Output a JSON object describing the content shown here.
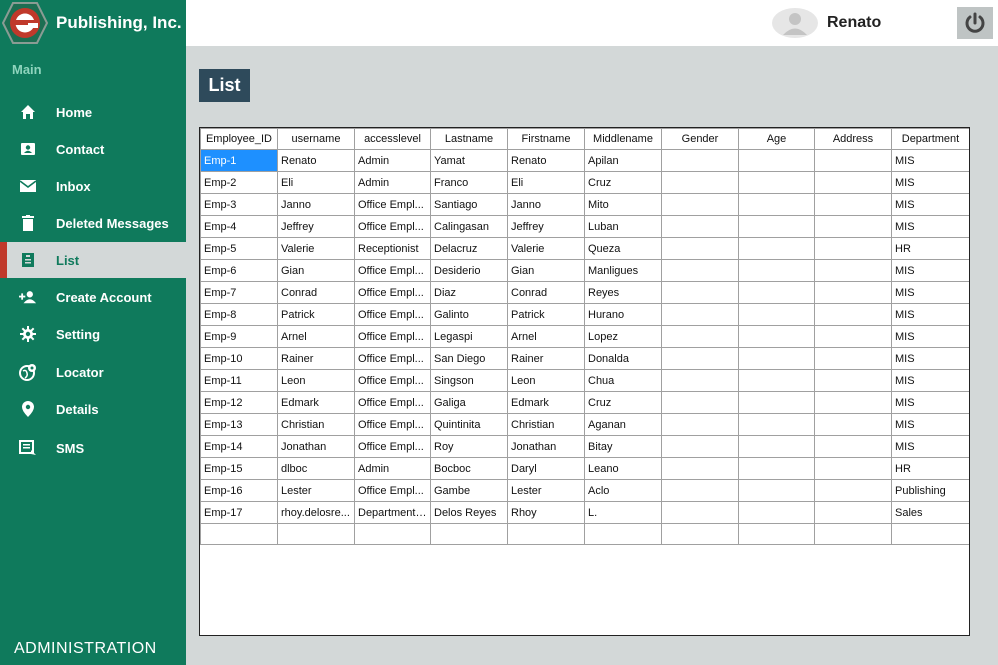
{
  "brand": {
    "name": "Publishing, Inc.",
    "logo_letter": "e",
    "color": "#0f7a5c",
    "accent": "#c0392b"
  },
  "topbar": {
    "user_name": "Renato",
    "avatar_icon": "user-avatar-icon",
    "logout_icon": "power-icon"
  },
  "sidebar": {
    "section_label": "Main",
    "items": [
      {
        "label": "Home",
        "icon": "home-icon"
      },
      {
        "label": "Contact",
        "icon": "contact-card-icon"
      },
      {
        "label": "Inbox",
        "icon": "mail-icon"
      },
      {
        "label": "Deleted Messages",
        "icon": "trash-icon"
      },
      {
        "label": "List",
        "icon": "list-icon",
        "active": true
      },
      {
        "label": "Create Account",
        "icon": "add-user-icon"
      },
      {
        "label": "Setting",
        "icon": "gear-icon"
      },
      {
        "label": "Locator",
        "icon": "globe-pin-icon"
      },
      {
        "label": "Details",
        "icon": "location-pin-icon"
      },
      {
        "label": "SMS",
        "icon": "sms-icon"
      }
    ],
    "footer_label": "ADMINISTRATION"
  },
  "main": {
    "title": "List",
    "table": {
      "columns": [
        "Employee_ID",
        "username",
        "accesslevel",
        "Lastname",
        "Firstname",
        "Middlename",
        "Gender",
        "Age",
        "Address",
        "Department"
      ],
      "selected_cell": [
        0,
        0
      ],
      "rows": [
        [
          "Emp-1",
          "Renato",
          "Admin",
          "Yamat",
          "Renato",
          "Apilan",
          "",
          "",
          "",
          "MIS"
        ],
        [
          "Emp-2",
          "Eli",
          "Admin",
          "Franco",
          "Eli",
          "Cruz",
          "",
          "",
          "",
          "MIS"
        ],
        [
          "Emp-3",
          "Janno",
          "Office Empl...",
          "Santiago",
          "Janno",
          "Mito",
          "",
          "",
          "",
          "MIS"
        ],
        [
          "Emp-4",
          "Jeffrey",
          "Office Empl...",
          "Calingasan",
          "Jeffrey",
          "Luban",
          "",
          "",
          "",
          "MIS"
        ],
        [
          "Emp-5",
          "Valerie",
          "Receptionist",
          "Delacruz",
          "Valerie",
          "Queza",
          "",
          "",
          "",
          "HR"
        ],
        [
          "Emp-6",
          "Gian",
          "Office Empl...",
          "Desiderio",
          "Gian",
          "Manligues",
          "",
          "",
          "",
          "MIS"
        ],
        [
          "Emp-7",
          "Conrad",
          "Office Empl...",
          "Diaz",
          "Conrad",
          "Reyes",
          "",
          "",
          "",
          "MIS"
        ],
        [
          "Emp-8",
          "Patrick",
          "Office Empl...",
          "Galinto",
          "Patrick",
          "Hurano",
          "",
          "",
          "",
          "MIS"
        ],
        [
          "Emp-9",
          "Arnel",
          "Office Empl...",
          "Legaspi",
          "Arnel",
          "Lopez",
          "",
          "",
          "",
          "MIS"
        ],
        [
          "Emp-10",
          "Rainer",
          "Office Empl...",
          "San Diego",
          "Rainer",
          "Donalda",
          "",
          "",
          "",
          "MIS"
        ],
        [
          "Emp-11",
          "Leon",
          "Office Empl...",
          "Singson",
          "Leon",
          "Chua",
          "",
          "",
          "",
          "MIS"
        ],
        [
          "Emp-12",
          "Edmark",
          "Office Empl...",
          "Galiga",
          "Edmark",
          "Cruz",
          "",
          "",
          "",
          "MIS"
        ],
        [
          "Emp-13",
          "Christian",
          "Office Empl...",
          "Quintinita",
          "Christian",
          "Aganan",
          "",
          "",
          "",
          "MIS"
        ],
        [
          "Emp-14",
          "Jonathan",
          "Office Empl...",
          "Roy",
          "Jonathan",
          "Bitay",
          "",
          "",
          "",
          "MIS"
        ],
        [
          "Emp-15",
          "dlboc",
          "Admin",
          "Bocboc",
          "Daryl",
          "Leano",
          "",
          "",
          "",
          "HR"
        ],
        [
          "Emp-16",
          "Lester",
          "Office Empl...",
          "Gambe",
          "Lester",
          "Aclo",
          "",
          "",
          "",
          "Publishing"
        ],
        [
          "Emp-17",
          "rhoy.delosre...",
          "Department ...",
          "Delos Reyes",
          "Rhoy",
          "L.",
          "",
          "",
          "",
          "Sales"
        ]
      ]
    }
  }
}
